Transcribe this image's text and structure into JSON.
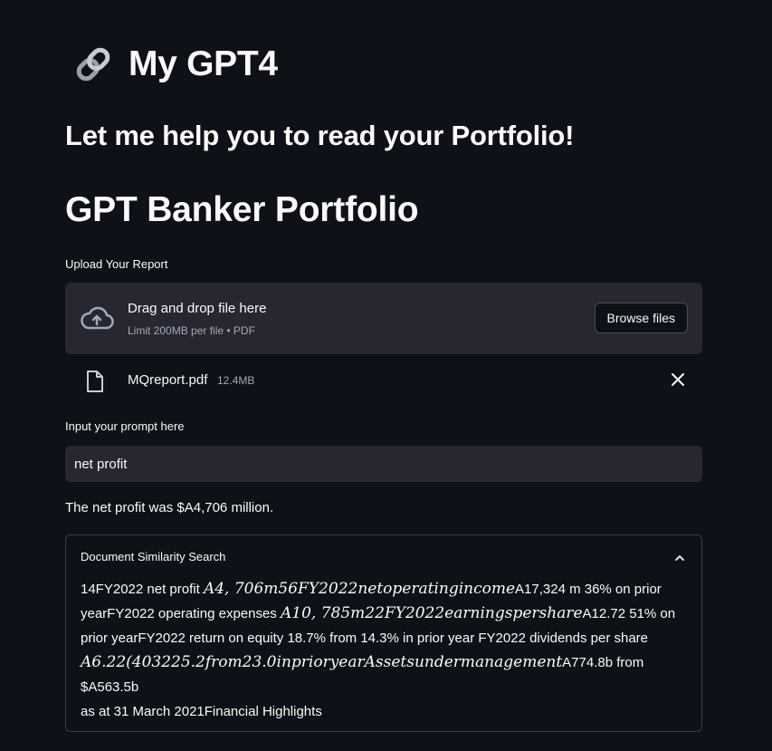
{
  "app": {
    "title_icon": "link-icon",
    "title": "My GPT4",
    "subtitle": "Let me help you to read your Portfolio!",
    "section_title": "GPT Banker Portfolio"
  },
  "uploader": {
    "label": "Upload Your Report",
    "drop_text": "Drag and drop file here",
    "limit_text": "Limit 200MB per file • PDF",
    "browse_label": "Browse files",
    "icon": "cloud-upload-icon",
    "file": {
      "name": "MQreport.pdf",
      "size": "12.4MB",
      "icon": "file-icon",
      "remove_icon": "close-icon"
    }
  },
  "prompt": {
    "label": "Input your prompt here",
    "value": "net profit"
  },
  "answer": "The net profit was $A4,706 million.",
  "similarity": {
    "title": "Document Similarity Search",
    "expanded": true,
    "lines": [
      {
        "pre": "14FY2022 net profit ",
        "math": "A4, 706m56FY2022netoperatingincome",
        "post": "A17,324 m 36% on prior"
      },
      {
        "pre": "yearFY2022 operating expenses ",
        "math": "A10, 785m22FY2022earningspershare",
        "post": "A12.72 51% on"
      },
      {
        "pre": "prior yearFY2022 return on equity 18.7% from 14.3% in prior year FY2022 dividends per share",
        "math": "",
        "post": ""
      },
      {
        "pre": "",
        "math": "A6.22(403225.2from23.0inprioryearAssetsundermanagement",
        "post": "A774.8b from"
      },
      {
        "pre": "$A563.5b",
        "math": "",
        "post": ""
      },
      {
        "pre": "as at 31 March 2021Financial Highlights",
        "math": "",
        "post": ""
      }
    ]
  },
  "colors": {
    "background": "#0e1117",
    "surface": "#262730",
    "text": "#fafafa",
    "muted": "#a3a8b8",
    "border": "#3a3d47"
  }
}
